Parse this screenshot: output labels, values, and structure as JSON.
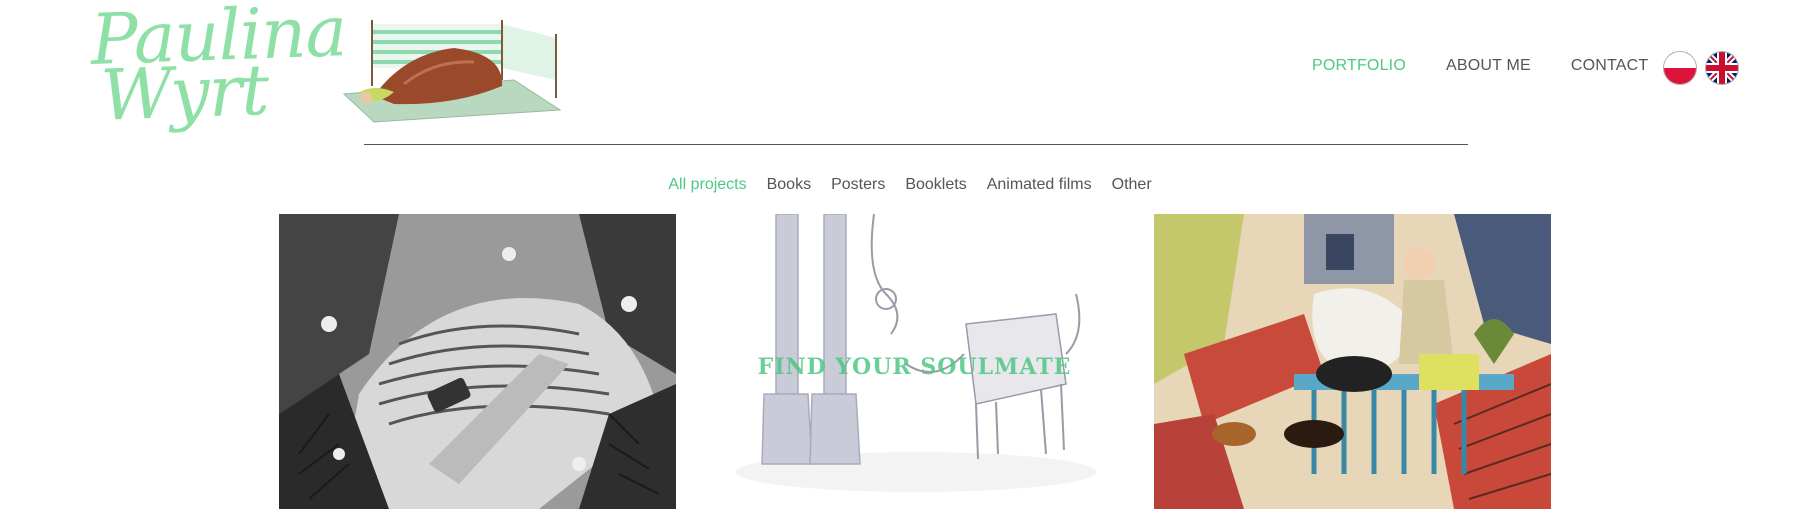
{
  "brand": {
    "name_line1": "Paulina",
    "name_line2": "Wyrt",
    "color": "#8ee0a7"
  },
  "nav": {
    "items": [
      {
        "label": "PORTFOLIO",
        "active": true
      },
      {
        "label": "ABOUT ME",
        "active": false
      },
      {
        "label": "CONTACT",
        "active": false
      }
    ],
    "active_color": "#4fc785"
  },
  "languages": [
    {
      "code": "pl",
      "icon": "poland-flag-icon"
    },
    {
      "code": "en",
      "icon": "uk-flag-icon"
    }
  ],
  "filters": {
    "items": [
      "All projects",
      "Books",
      "Posters",
      "Booklets",
      "Animated films",
      "Other"
    ],
    "active": "All projects"
  },
  "portfolio": {
    "tiles": [
      {
        "name": "forest-illustration",
        "caption": ""
      },
      {
        "name": "soulmate-illustration",
        "caption": "FIND YOUR SOULMATE"
      },
      {
        "name": "rooftop-dogs-illustration",
        "caption": ""
      }
    ]
  }
}
